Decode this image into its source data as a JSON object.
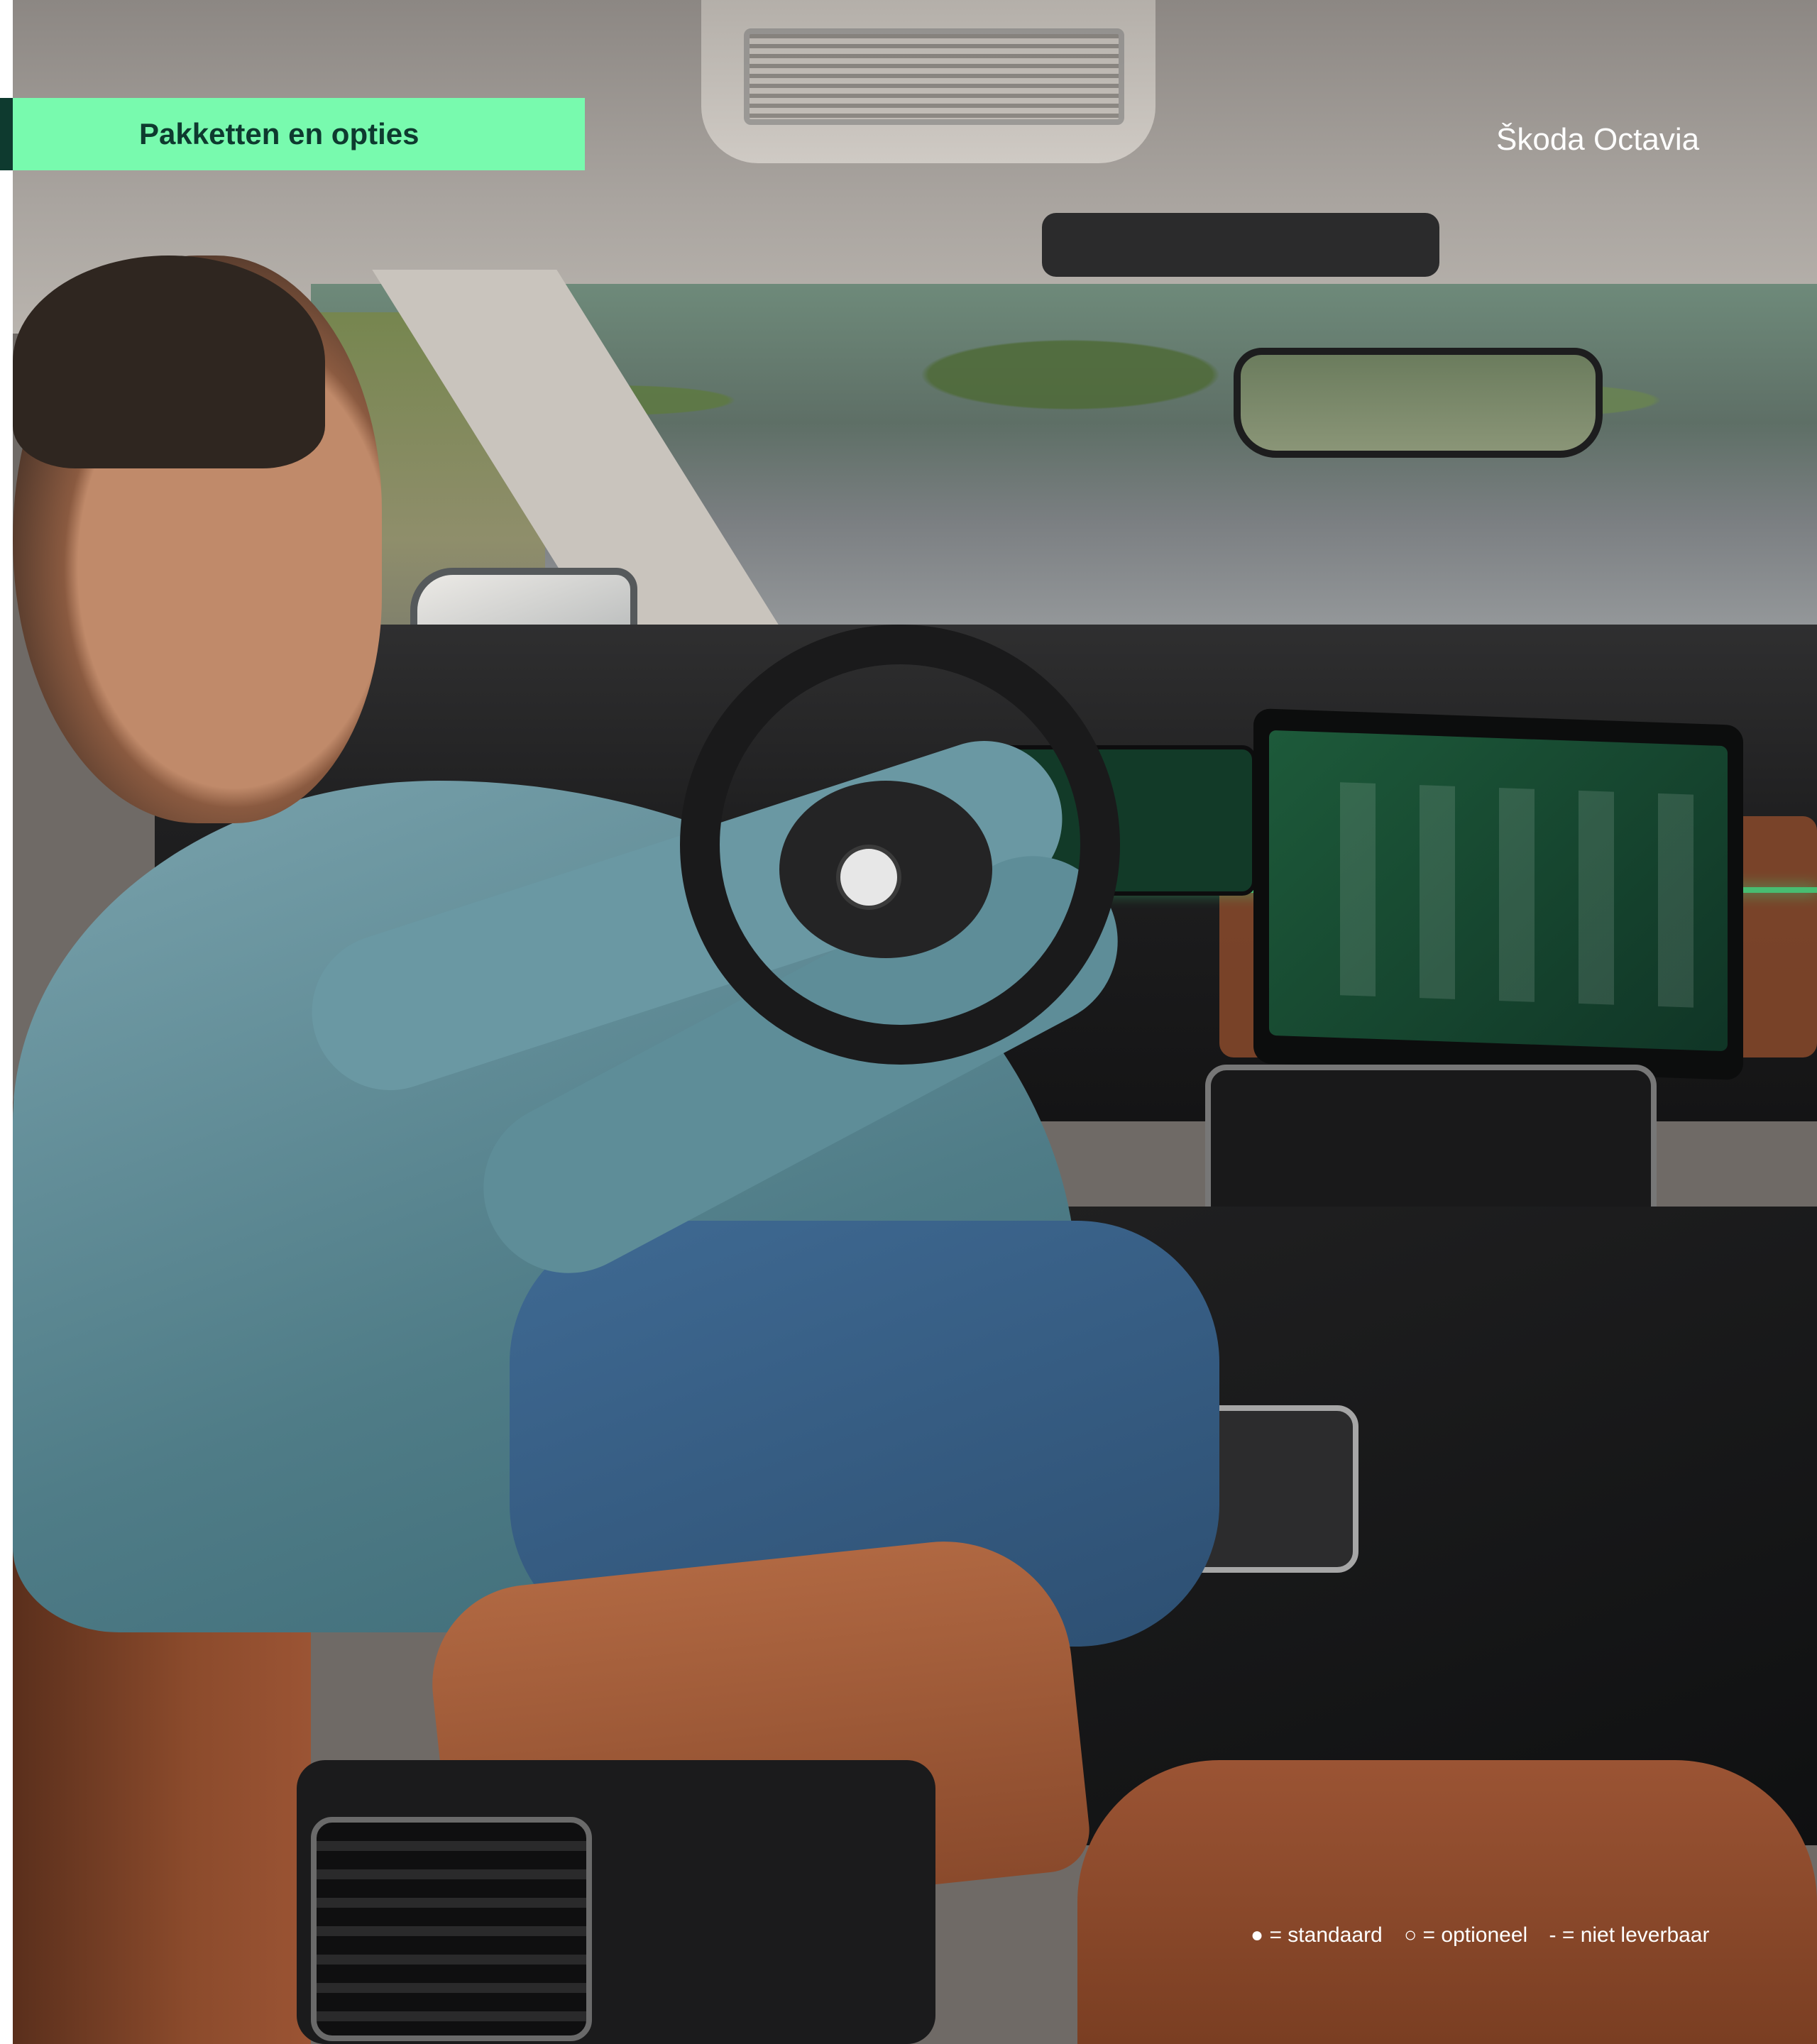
{
  "section_title": "Pakketten en opties",
  "brand_model": "Škoda Octavia",
  "legend": {
    "standard": "● = standaard",
    "optional": "○ = optioneel",
    "not_available": "- = niet leverbaar"
  },
  "colors": {
    "accent_green": "#78faae",
    "dark_green": "#0e3a2f"
  }
}
